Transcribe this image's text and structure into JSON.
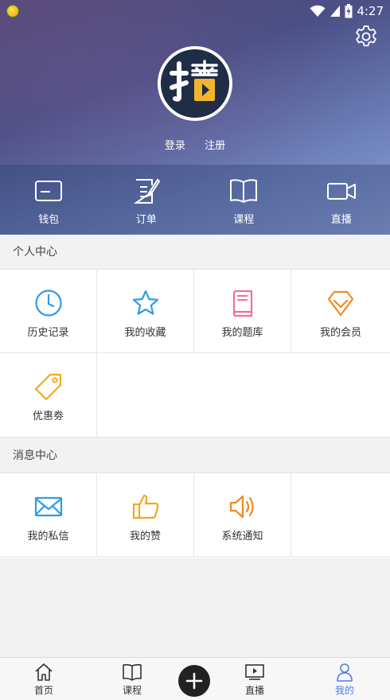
{
  "status": {
    "time": "4:27"
  },
  "profile": {
    "avatar_text": "播",
    "login_label": "登录",
    "register_label": "注册"
  },
  "quick": [
    {
      "label": "钱包",
      "icon": "wallet-icon"
    },
    {
      "label": "订单",
      "icon": "order-icon"
    },
    {
      "label": "课程",
      "icon": "book-icon"
    },
    {
      "label": "直播",
      "icon": "video-camera-icon"
    }
  ],
  "personal": {
    "title": "个人中心",
    "items": [
      {
        "label": "历史记录",
        "icon": "clock-icon",
        "color": "#2f9be8"
      },
      {
        "label": "我的收藏",
        "icon": "star-icon",
        "color": "#2f9be8"
      },
      {
        "label": "我的题库",
        "icon": "question-bank-icon",
        "color": "#f26ea0"
      },
      {
        "label": "我的会员",
        "icon": "member-diamond-icon",
        "color": "#f28a1e"
      },
      {
        "label": "优惠劵",
        "icon": "coupon-tag-icon",
        "color": "#f2a81e"
      }
    ]
  },
  "messages": {
    "title": "消息中心",
    "items": [
      {
        "label": "我的私信",
        "icon": "mail-icon",
        "color": "#2f9be8"
      },
      {
        "label": "我的赞",
        "icon": "thumbs-up-icon",
        "color": "#f2a81e"
      },
      {
        "label": "系统通知",
        "icon": "speaker-icon",
        "color": "#f28a1e"
      }
    ]
  },
  "nav": {
    "home": "首页",
    "course": "课程",
    "live": "直播",
    "mine": "我的",
    "active_color": "#4a7ee6"
  }
}
